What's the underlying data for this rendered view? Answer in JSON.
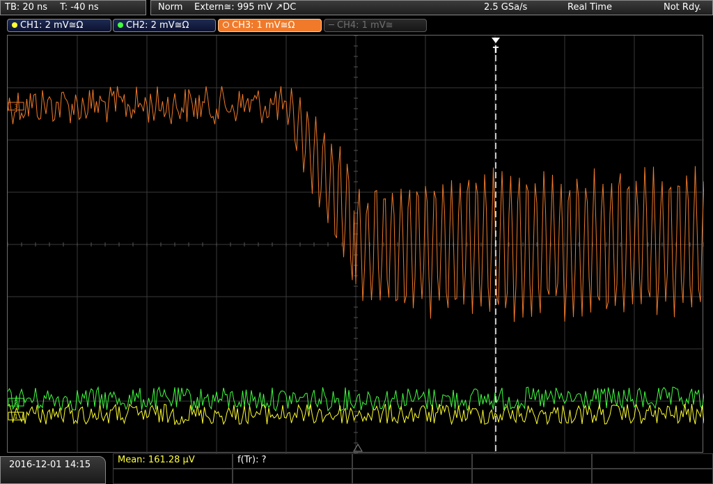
{
  "topbar": {
    "timebase": "TB: 20 ns",
    "trigger_offset": "T: -40 ns",
    "trigger_mode": "Norm",
    "trigger_source": "Extern≅: 995 mV ↗DC",
    "sample_rate": "2.5 GSa/s",
    "acquisition_mode": "Real Time",
    "status": "Not Rdy."
  },
  "channels": [
    {
      "label": "CH1: 2 mV≅Ω",
      "color": "#ffff30",
      "state": "on"
    },
    {
      "label": "CH2: 2 mV≅Ω",
      "color": "#40ff40",
      "state": "on"
    },
    {
      "label": "CH3: 1 mV≅Ω",
      "color": "#f07a2a",
      "state": "active"
    },
    {
      "label": "CH4: 1 mV≅",
      "color": "#707070",
      "state": "off"
    }
  ],
  "channel_markers": [
    "3",
    "2",
    "1"
  ],
  "trigger_marker": "T",
  "measurements": {
    "mean": "Mean: 161.28 µV",
    "rise_time": "f(Tr): ?"
  },
  "datetime": "2016-12-01 14:15",
  "colors": {
    "ch1": "#ffff30",
    "ch2": "#40ff40",
    "ch3": "#f07a2a",
    "grid": "#3a3a3a",
    "trigger_line": "#ffffff"
  }
}
